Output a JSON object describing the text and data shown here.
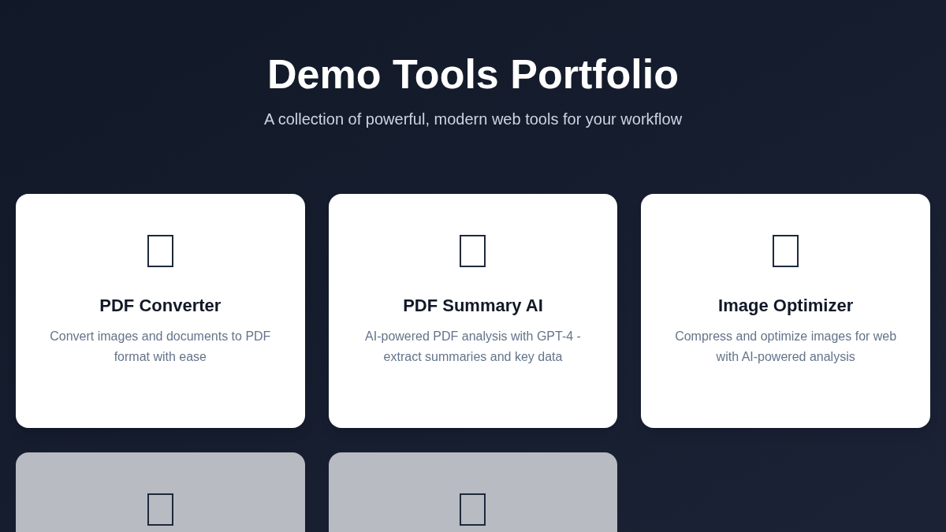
{
  "header": {
    "title": "Demo Tools Portfolio",
    "subtitle": "A collection of powerful, modern web tools for your workflow"
  },
  "tools": [
    {
      "title": "PDF Converter",
      "description": "Convert images and documents to PDF format with ease",
      "disabled": false
    },
    {
      "title": "PDF Summary AI",
      "description": "AI-powered PDF analysis with GPT-4 - extract summaries and key data",
      "disabled": false
    },
    {
      "title": "Image Optimizer",
      "description": "Compress and optimize images for web with AI-powered analysis",
      "disabled": false
    },
    {
      "disabled": true
    },
    {
      "disabled": true
    }
  ]
}
